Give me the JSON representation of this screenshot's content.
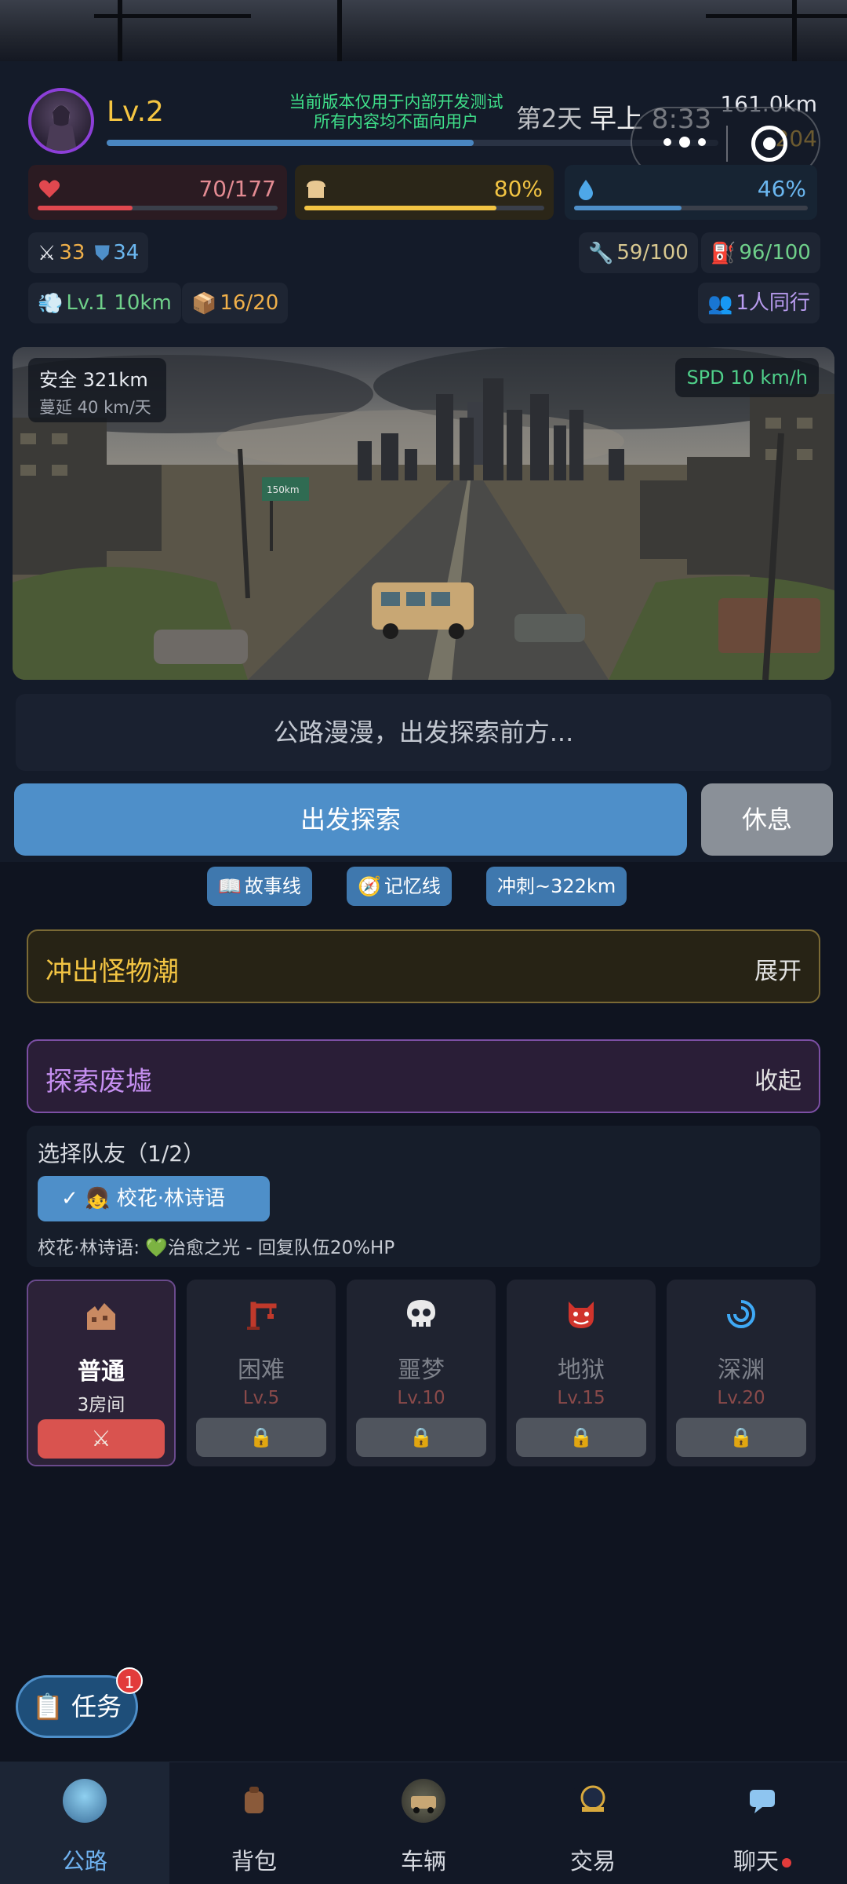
{
  "header": {
    "level": "Lv.2",
    "exp_progress": 0.6,
    "dev_notice_line1": "当前版本仅用于内部开发测试",
    "dev_notice_line2": "所有内容均不面向用户",
    "day": "第2天",
    "time": "早上 8:33",
    "distance": "161.0km",
    "gold": "204"
  },
  "stats": {
    "hp": {
      "value": "70/177",
      "progress": 0.395,
      "color": "#e0484f"
    },
    "food": {
      "value": "80%",
      "progress": 0.8,
      "color": "#f2c443"
    },
    "water": {
      "value": "46%",
      "progress": 0.46,
      "color": "#4e8fc9"
    }
  },
  "chips": {
    "attack": "33",
    "defense": "34",
    "durability": "59/100",
    "fuel": "96/100",
    "vehicle_level": "Lv.1 10km",
    "cargo": "16/20",
    "companions": "1人同行"
  },
  "scene": {
    "safe": "安全 321km",
    "spread": "蔓延 40 km/天",
    "speed": "SPD 10 km/h",
    "road_sign": "150km"
  },
  "story_text": "公路漫漫，出发探索前方...",
  "actions": {
    "explore": "出发探索",
    "rest": "休息"
  },
  "quick_links": {
    "story": "故事线",
    "memory": "记忆线",
    "sprint": "冲刺~322km"
  },
  "panels": {
    "monster_title": "冲出怪物潮",
    "monster_action": "展开",
    "ruins_title": "探索废墟",
    "ruins_action": "收起"
  },
  "team": {
    "title": "选择队友（1/2）",
    "member": "校花·林诗语",
    "skill": "校花·林诗语: 💚治愈之光 - 回复队伍20%HP"
  },
  "difficulties": [
    {
      "name": "普通",
      "sub": "3房间"
    },
    {
      "name": "困难",
      "sub": "Lv.5"
    },
    {
      "name": "噩梦",
      "sub": "Lv.10"
    },
    {
      "name": "地狱",
      "sub": "Lv.15"
    },
    {
      "name": "深渊",
      "sub": "Lv.20"
    }
  ],
  "task": {
    "label": "任务",
    "badge": "1"
  },
  "nav": {
    "road": "公路",
    "backpack": "背包",
    "vehicle": "车辆",
    "trade": "交易",
    "chat": "聊天"
  }
}
